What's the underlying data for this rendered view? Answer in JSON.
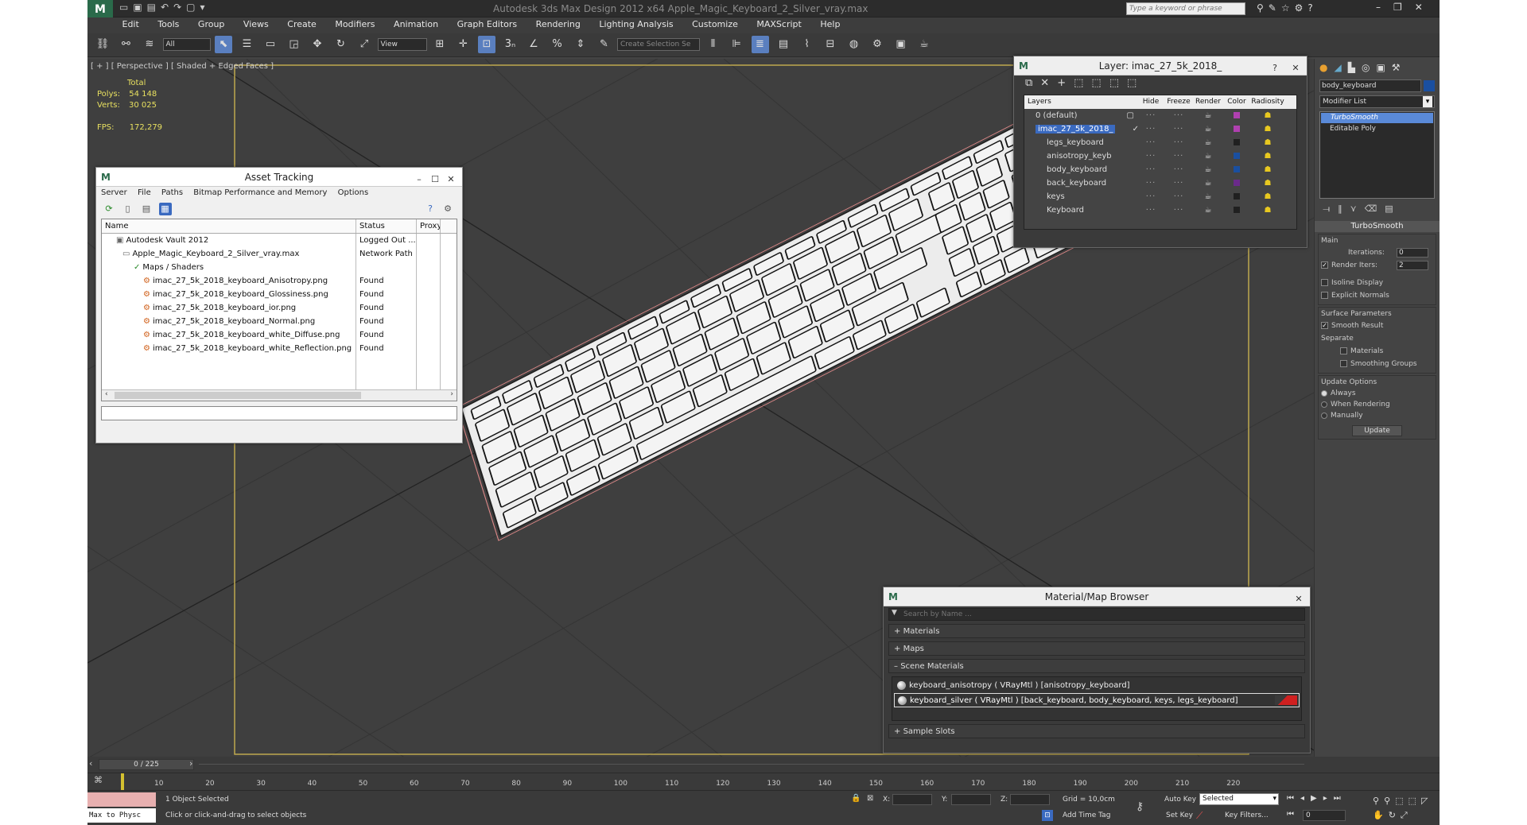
{
  "titlebar": {
    "title": "Autodesk 3ds Max Design 2012 x64      Apple_Magic_Keyboard_2_Silver_vray.max",
    "search_placeholder": "Type a keyword or phrase"
  },
  "menu": [
    "Edit",
    "Tools",
    "Group",
    "Views",
    "Create",
    "Modifiers",
    "Animation",
    "Graph Editors",
    "Rendering",
    "Lighting Analysis",
    "Customize",
    "MAXScript",
    "Help"
  ],
  "toolbar": {
    "filter": "All",
    "refcoord": "View",
    "selset_placeholder": "Create Selection Se"
  },
  "viewport": {
    "label": "[ + ] [ Perspective ] [ Shaded + Edged Faces ]",
    "stats": {
      "total_label": "Total",
      "polys_label": "Polys:",
      "polys": "54 148",
      "verts_label": "Verts:",
      "verts": "30 025",
      "fps_label": "FPS:",
      "fps": "172,279"
    }
  },
  "asset_tracking": {
    "title": "Asset Tracking",
    "menu": [
      "Server",
      "File",
      "Paths",
      "Bitmap Performance and Memory",
      "Options"
    ],
    "columns": [
      "Name",
      "Status",
      "Proxy"
    ],
    "rows": [
      {
        "name": "Autodesk Vault 2012",
        "status": "Logged Out ..."
      },
      {
        "name": "Apple_Magic_Keyboard_2_Silver_vray.max",
        "status": "Network Path"
      },
      {
        "name": "Maps / Shaders",
        "status": ""
      },
      {
        "name": "imac_27_5k_2018_keyboard_Anisotropy.png",
        "status": "Found"
      },
      {
        "name": "imac_27_5k_2018_keyboard_Glossiness.png",
        "status": "Found"
      },
      {
        "name": "imac_27_5k_2018_keyboard_ior.png",
        "status": "Found"
      },
      {
        "name": "imac_27_5k_2018_keyboard_Normal.png",
        "status": "Found"
      },
      {
        "name": "imac_27_5k_2018_keyboard_white_Diffuse.png",
        "status": "Found"
      },
      {
        "name": "imac_27_5k_2018_keyboard_white_Reflection.png",
        "status": "Found"
      }
    ]
  },
  "layer": {
    "title": "Layer: imac_27_5k_2018_",
    "columns": [
      "Layers",
      "Hide",
      "Freeze",
      "Render",
      "Color",
      "Radiosity"
    ],
    "rows": [
      {
        "name": "0 (default)",
        "color": "#b040b0"
      },
      {
        "name": "imac_27_5k_2018_",
        "color": "#b040b0"
      },
      {
        "name": "legs_keyboard",
        "color": "#202020"
      },
      {
        "name": "anisotropy_keyb",
        "color": "#1a4fa0"
      },
      {
        "name": "body_keyboard",
        "color": "#1a4fa0"
      },
      {
        "name": "back_keyboard",
        "color": "#6a2a8a"
      },
      {
        "name": "keys",
        "color": "#202020"
      },
      {
        "name": "Keyboard",
        "color": "#202020"
      }
    ]
  },
  "material_browser": {
    "title": "Material/Map Browser",
    "search_placeholder": "Search by Name ...",
    "sections": [
      "Materials",
      "Maps",
      "Scene Materials"
    ],
    "scene_materials": [
      "keyboard_anisotropy ( VRayMtl ) [anisotropy_keyboard]",
      "keyboard_silver ( VRayMtl ) [back_keyboard, body_keyboard, keys, legs_keyboard]"
    ],
    "sample_slots": "Sample Slots"
  },
  "cmdpanel": {
    "object_name": "body_keyboard",
    "modifier_list": "Modifier List",
    "stack": [
      "TurboSmooth",
      "Editable Poly"
    ],
    "rollout": "TurboSmooth",
    "main": "Main",
    "iterations_label": "Iterations:",
    "iterations": "0",
    "render_iters_label": "Render Iters:",
    "render_iters": "2",
    "isoline": "Isoline Display",
    "explicit": "Explicit Normals",
    "surface": "Surface Parameters",
    "smooth": "Smooth Result",
    "separate": "Separate",
    "materials": "Materials",
    "smoothing": "Smoothing Groups",
    "update_opts": "Update Options",
    "always": "Always",
    "when_rendering": "When Rendering",
    "manually": "Manually",
    "update_btn": "Update"
  },
  "timeline": {
    "frame": "0 / 225",
    "ticks": [
      "10",
      "20",
      "30",
      "40",
      "50",
      "60",
      "70",
      "80",
      "90",
      "100",
      "110",
      "120",
      "130",
      "140",
      "150",
      "160",
      "170",
      "180",
      "190",
      "200",
      "210",
      "220"
    ]
  },
  "status": {
    "script": "Max to Physc",
    "selected": "1 Object Selected",
    "prompt": "Click or click-and-drag to select objects",
    "x": "X:",
    "y": "Y:",
    "z": "Z:",
    "grid": "Grid = 10,0cm",
    "add_time_tag": "Add Time Tag",
    "auto_key": "Auto Key",
    "set_key": "Set Key",
    "key_mode": "Selected",
    "key_filters": "Key Filters...",
    "frame_field": "0"
  }
}
